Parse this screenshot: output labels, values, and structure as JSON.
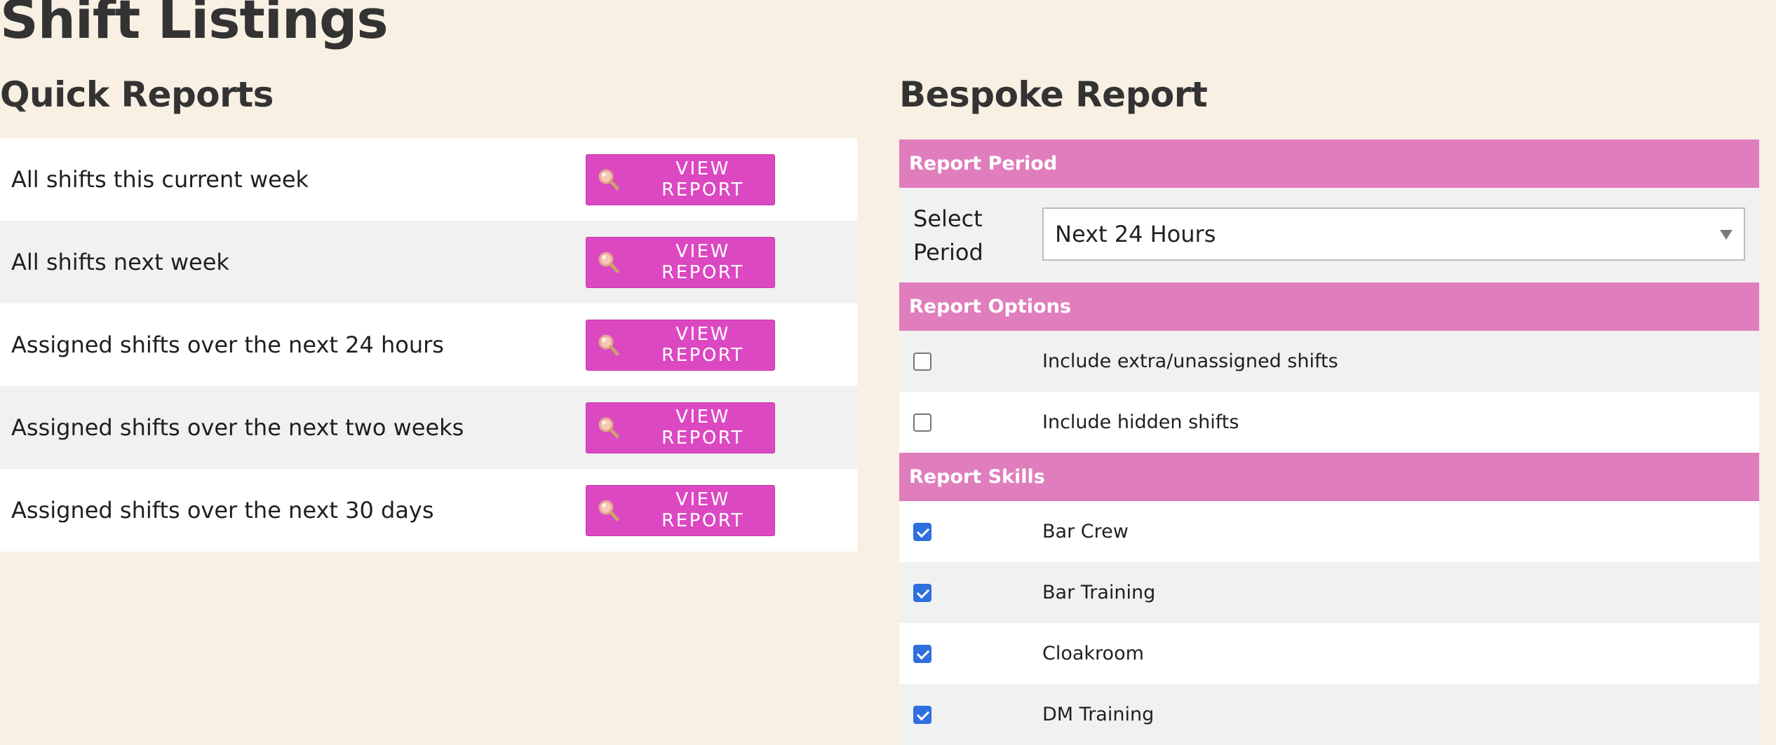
{
  "page": {
    "title": "Shift Listings"
  },
  "quick_reports": {
    "title": "Quick Reports",
    "button_label": "VIEW REPORT",
    "button_icon": "magnifier-icon",
    "items": [
      {
        "label": "All shifts this current week"
      },
      {
        "label": "All shifts next week"
      },
      {
        "label": "Assigned shifts over the next 24 hours"
      },
      {
        "label": "Assigned shifts over the next two weeks"
      },
      {
        "label": "Assigned shifts over the next 30 days"
      }
    ]
  },
  "bespoke_report": {
    "title": "Bespoke Report",
    "period": {
      "header": "Report Period",
      "label": "Select Period",
      "selected": "Next 24 Hours"
    },
    "options": {
      "header": "Report Options",
      "items": [
        {
          "label": "Include extra/unassigned shifts",
          "checked": false
        },
        {
          "label": "Include hidden shifts",
          "checked": false
        }
      ]
    },
    "skills": {
      "header": "Report Skills",
      "items": [
        {
          "label": "Bar Crew",
          "checked": true
        },
        {
          "label": "Bar Training",
          "checked": true
        },
        {
          "label": "Cloakroom",
          "checked": true
        },
        {
          "label": "DM Training",
          "checked": true
        }
      ]
    }
  },
  "colors": {
    "background": "#f8f0e3",
    "button": "#dc48c2",
    "section_header": "#e07dbd",
    "checkbox_checked": "#2f6fde"
  }
}
